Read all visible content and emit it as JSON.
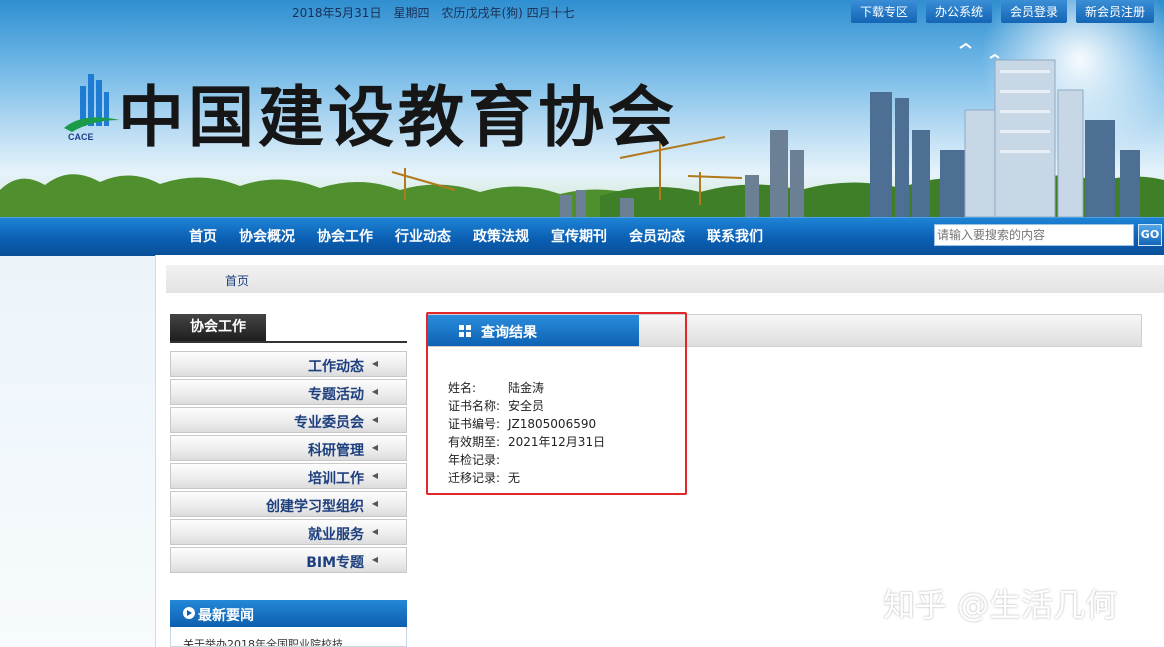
{
  "topbar": {
    "date_text": "2018年5月31日　星期四　农历戊戌年(狗) 四月十七",
    "links": [
      "下载专区",
      "办公系统",
      "会员登录",
      "新会员注册"
    ]
  },
  "header": {
    "site_title": "中国建设教育协会",
    "logo_text": "CACE"
  },
  "nav": {
    "items": [
      "首页",
      "协会概况",
      "协会工作",
      "行业动态",
      "政策法规",
      "宣传期刊",
      "会员动态",
      "联系我们"
    ],
    "search_placeholder": "请输入要搜索的内容",
    "search_button": "GO"
  },
  "breadcrumb": {
    "home": "首页"
  },
  "sidebar": {
    "title": "协会工作",
    "items": [
      "工作动态",
      "专题活动",
      "专业委员会",
      "科研管理",
      "培训工作",
      "创建学习型组织",
      "就业服务",
      "BIM专题"
    ],
    "news_title": "最新要闻",
    "news_item": "关于举办2018年全国职业院校技"
  },
  "result": {
    "title": "查询结果",
    "fields": [
      {
        "label": "姓名:",
        "value": "陆金涛"
      },
      {
        "label": "证书名称:",
        "value": "安全员"
      },
      {
        "label": "证书编号:",
        "value": "JZ1805006590"
      },
      {
        "label": "有效期至:",
        "value": "2021年12月31日"
      },
      {
        "label": "年检记录:",
        "value": ""
      },
      {
        "label": "迁移记录:",
        "value": "无"
      }
    ]
  },
  "watermark": "知乎 @生活几何",
  "colors": {
    "nav_blue": "#0b5fb3",
    "highlight_red": "#e3262a"
  }
}
